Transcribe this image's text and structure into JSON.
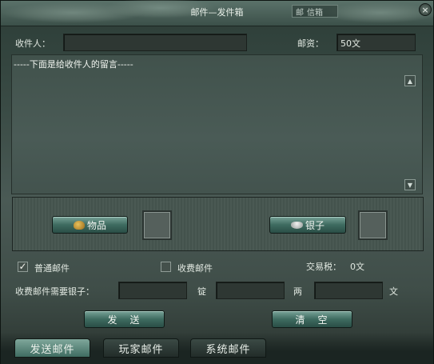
{
  "window": {
    "title": "邮件—发件箱",
    "titlebar_buttons": [
      "邮",
      "信箱"
    ],
    "close_glyph": "×"
  },
  "header": {
    "recipient_label": "收件人：",
    "recipient_value": "",
    "postage_label": "邮资：",
    "postage_value": "50文"
  },
  "message": {
    "hint": "-----下面是给收件人的留言-----"
  },
  "attach": {
    "item_button": "物品",
    "silver_button": "银子"
  },
  "options": {
    "normal_mail": "普通邮件",
    "normal_checked": true,
    "paid_mail": "收费邮件",
    "paid_checked": false,
    "tax_label": "交易税：",
    "tax_value": "0文"
  },
  "paid": {
    "label": "收费邮件需要银子：",
    "unit_ding": "锭",
    "unit_liang": "两",
    "unit_wen": "文"
  },
  "actions": {
    "send": "发　送",
    "clear": "清　空"
  },
  "tabs": [
    "发送邮件",
    "玩家邮件",
    "系统邮件"
  ],
  "colors": {
    "accent": "#4f7d71",
    "panel": "#46554f"
  }
}
